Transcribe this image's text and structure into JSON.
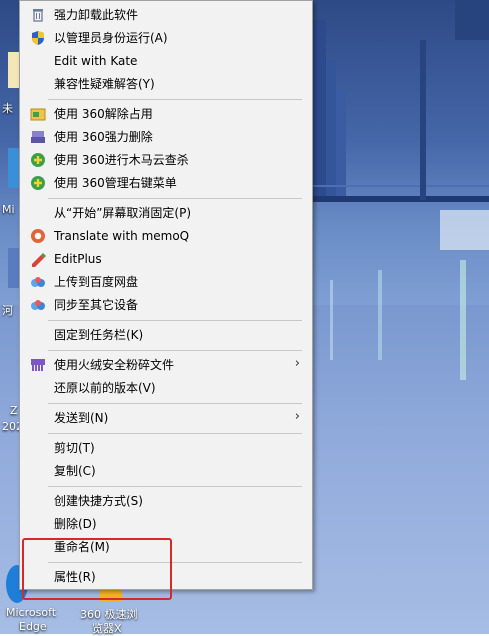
{
  "menu": {
    "items": [
      {
        "label": "强力卸载此软件",
        "icon": "trash-icon"
      },
      {
        "label": "以管理员身份运行(A)",
        "icon": "shield-icon"
      },
      {
        "label": "Edit with Kate",
        "icon": ""
      },
      {
        "label": "兼容性疑难解答(Y)",
        "icon": ""
      },
      {
        "label": "使用 360解除占用",
        "icon": "360-unlock-icon"
      },
      {
        "label": "使用 360强力删除",
        "icon": "360-shred-icon"
      },
      {
        "label": "使用 360进行木马云查杀",
        "icon": "360-scan-icon"
      },
      {
        "label": "使用 360管理右键菜单",
        "icon": "360-menu-icon"
      },
      {
        "label": "从“开始”屏幕取消固定(P)",
        "icon": ""
      },
      {
        "label": "Translate with memoQ",
        "icon": "memoq-icon"
      },
      {
        "label": "EditPlus",
        "icon": "editplus-icon"
      },
      {
        "label": "上传到百度网盘",
        "icon": "baidu-cloud-icon"
      },
      {
        "label": "同步至其它设备",
        "icon": "baidu-cloud-icon"
      },
      {
        "label": "固定到任务栏(K)",
        "icon": ""
      },
      {
        "label": "使用火绒安全粉碎文件",
        "icon": "huorong-icon",
        "submenu": true
      },
      {
        "label": "还原以前的版本(V)",
        "icon": ""
      },
      {
        "label": "发送到(N)",
        "icon": "",
        "submenu": true
      },
      {
        "label": "剪切(T)",
        "icon": ""
      },
      {
        "label": "复制(C)",
        "icon": ""
      },
      {
        "label": "创建快捷方式(S)",
        "icon": ""
      },
      {
        "label": "删除(D)",
        "icon": ""
      },
      {
        "label": "重命名(M)",
        "icon": ""
      },
      {
        "label": "属性(R)",
        "icon": ""
      }
    ],
    "submenu_arrow": "›"
  },
  "desktop": {
    "labels": [
      "未",
      "Mi",
      "河",
      "Z",
      "202",
      "Microsoft",
      "Edge",
      "360 极速浏",
      "览器X"
    ]
  },
  "colors": {
    "highlight_box": "#d22b2b",
    "menu_bg": "#f2f2f2"
  }
}
